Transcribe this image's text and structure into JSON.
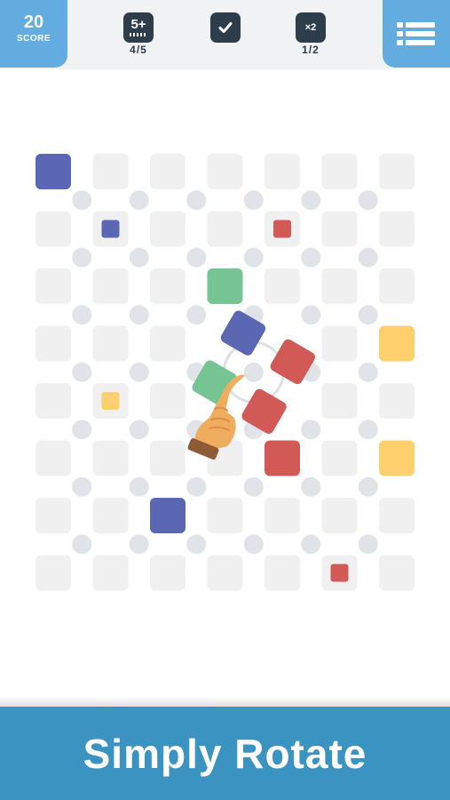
{
  "header": {
    "score_value": "20",
    "score_label": "SCORE",
    "goals": [
      {
        "icon": "five-plus-icon",
        "badge_text": "5+",
        "count": "4/5"
      },
      {
        "icon": "checkmark-icon",
        "count": ""
      },
      {
        "icon": "times-two-icon",
        "badge_text": "×2",
        "count": "1/2"
      }
    ],
    "menu_icon": "list-menu-icon"
  },
  "colors": {
    "blue": "#5b67b3",
    "green": "#76c394",
    "red": "#d15a57",
    "yellow": "#fdd06d",
    "empty_cell": "#f0f0f1",
    "pivot_dot": "#e0e3e8",
    "accent": "#62ace0",
    "footer": "#3a93c0"
  },
  "board": {
    "cols": 7,
    "rows": 8,
    "cells": [
      {
        "col": 0,
        "row": 0,
        "color": "blue",
        "size": "large"
      },
      {
        "col": 1,
        "row": 1,
        "color": "blue",
        "size": "small"
      },
      {
        "col": 4,
        "row": 1,
        "color": "red",
        "size": "small"
      },
      {
        "col": 3,
        "row": 2,
        "color": "green",
        "size": "large"
      },
      {
        "col": 6,
        "row": 3,
        "color": "yellow",
        "size": "large"
      },
      {
        "col": 1,
        "row": 4,
        "color": "yellow",
        "size": "small"
      },
      {
        "col": 4,
        "row": 5,
        "color": "red",
        "size": "large"
      },
      {
        "col": 6,
        "row": 5,
        "color": "yellow",
        "size": "large"
      },
      {
        "col": 2,
        "row": 6,
        "color": "blue",
        "size": "large"
      },
      {
        "col": 5,
        "row": 7,
        "color": "red",
        "size": "small"
      }
    ],
    "rotating_group": {
      "pivot_col": 3,
      "pivot_row": 3,
      "angle_deg": 30,
      "tiles": [
        {
          "corner": "top-left",
          "color": "blue"
        },
        {
          "corner": "top-right",
          "color": "red"
        },
        {
          "corner": "bottom-right",
          "color": "red"
        },
        {
          "corner": "bottom-left",
          "color": "green"
        }
      ]
    },
    "hand_icon": "pointing-hand-icon"
  },
  "footer": {
    "title": "Simply Rotate"
  }
}
